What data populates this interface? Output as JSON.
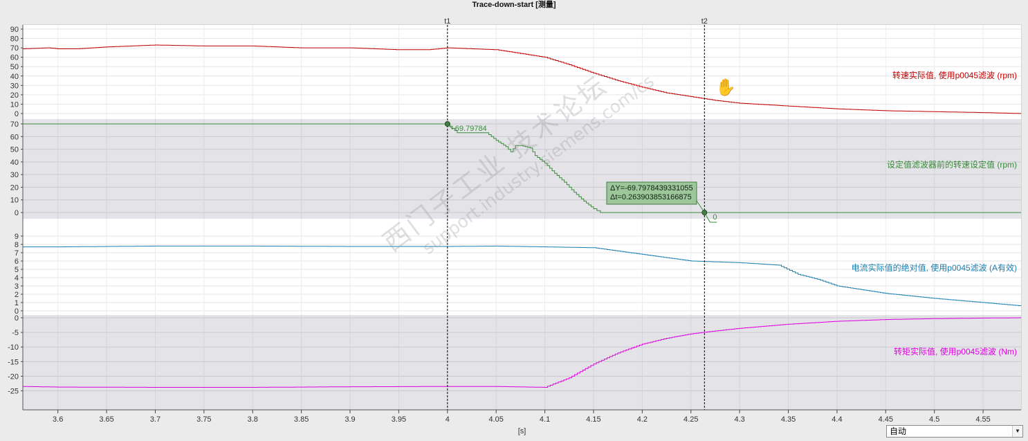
{
  "title": "Trace-down-start [测量]",
  "x_unit": "[s]",
  "mode_select": {
    "value": "自动"
  },
  "cursors": [
    {
      "label": "t1",
      "x": 4.0
    },
    {
      "label": "t2",
      "x": 4.2639
    }
  ],
  "point_labels": {
    "t1_value": "69.79784",
    "t2_value": "0"
  },
  "delta_box": {
    "dy": "ΔY=-69.7978439331055",
    "dt": "Δt=0.263903853166875"
  },
  "watermark": {
    "line1": "西门子工业 技术论坛",
    "line2": "support.industry.siemens.com/cs"
  },
  "colors": {
    "speed": "#c00000",
    "setpoint": "#3a8a3a",
    "current": "#1a7fb0",
    "torque": "#e000e0",
    "cursor": "#000000",
    "bg": "#ebebeb",
    "panel_alt": "#e4e4e8"
  },
  "chart_data": {
    "type": "line",
    "xlim": [
      3.564,
      4.589
    ],
    "x_ticks": [
      "3.6",
      "3.65",
      "3.7",
      "3.75",
      "3.8",
      "3.85",
      "3.9",
      "3.95",
      "4",
      "4.05",
      "4.1",
      "4.15",
      "4.2",
      "4.25",
      "4.3",
      "4.35",
      "4.4",
      "4.45",
      "4.5",
      "4.55"
    ],
    "panels": [
      {
        "name": "转速实际值, 使用p0045滤波 (rpm)",
        "ylim": [
          0,
          90
        ],
        "y_ticks": [
          90,
          80,
          70,
          60,
          50,
          40,
          30,
          20,
          10,
          0
        ],
        "x": [
          3.564,
          3.59,
          3.6,
          3.62,
          3.65,
          3.7,
          3.75,
          3.8,
          3.85,
          3.9,
          3.95,
          3.98,
          4.0,
          4.05,
          4.1,
          4.125,
          4.15,
          4.175,
          4.2,
          4.225,
          4.25,
          4.275,
          4.3,
          4.35,
          4.4,
          4.45,
          4.5,
          4.55,
          4.589
        ],
        "y": [
          69,
          70,
          69,
          69,
          71,
          73,
          72,
          72,
          70,
          70,
          68,
          68,
          70,
          68,
          60,
          52,
          43,
          35,
          28,
          22,
          18,
          14,
          11,
          8,
          5,
          3,
          2,
          1,
          0
        ]
      },
      {
        "name": "设定值滤波器前的转速设定值 (rpm)",
        "ylim": [
          0,
          70
        ],
        "y_ticks": [
          70,
          60,
          50,
          40,
          30,
          20,
          10,
          0
        ],
        "x": [
          3.564,
          4.0,
          4.01,
          4.03,
          4.04,
          4.05,
          4.06,
          4.065,
          4.07,
          4.075,
          4.085,
          4.09,
          4.1,
          4.11,
          4.12,
          4.13,
          4.14,
          4.15,
          4.157,
          4.2,
          4.26,
          4.589
        ],
        "y": [
          70,
          70,
          63,
          63,
          63,
          57,
          52,
          48,
          53,
          53,
          51,
          45,
          39,
          31,
          24,
          16,
          9,
          3,
          0,
          0,
          0,
          0
        ]
      },
      {
        "name": "电流实际值的绝对值, 使用p0045滤波 (A有效)",
        "ylim": [
          0,
          9
        ],
        "y_ticks": [
          9,
          8,
          7,
          6,
          5,
          4,
          3,
          2,
          1,
          0
        ],
        "x": [
          3.564,
          3.6,
          3.7,
          3.8,
          3.9,
          4.0,
          4.05,
          4.1,
          4.15,
          4.2,
          4.25,
          4.3,
          4.34,
          4.36,
          4.38,
          4.4,
          4.45,
          4.5,
          4.55,
          4.589
        ],
        "y": [
          7.7,
          7.7,
          7.8,
          7.8,
          7.75,
          7.75,
          7.8,
          7.7,
          7.6,
          6.8,
          6.0,
          5.8,
          5.5,
          4.4,
          3.8,
          3.0,
          2.1,
          1.5,
          1.0,
          0.6
        ]
      },
      {
        "name": "转矩实际值, 使用p0045滤波 (Nm)",
        "ylim": [
          -27,
          0
        ],
        "y_ticks": [
          0,
          -5,
          -10,
          -15,
          -20,
          -25
        ],
        "x": [
          3.564,
          3.6,
          3.7,
          3.8,
          3.9,
          4.0,
          4.05,
          4.1,
          4.125,
          4.15,
          4.175,
          4.2,
          4.225,
          4.25,
          4.275,
          4.3,
          4.35,
          4.4,
          4.45,
          4.5,
          4.55,
          4.589
        ],
        "y": [
          -23.5,
          -23.7,
          -23.8,
          -23.8,
          -23.6,
          -23.5,
          -23.5,
          -23.8,
          -20.5,
          -15.8,
          -12,
          -9,
          -7,
          -5.5,
          -4.5,
          -3.6,
          -2.2,
          -1.2,
          -0.6,
          -0.3,
          -0.1,
          0
        ]
      }
    ]
  }
}
